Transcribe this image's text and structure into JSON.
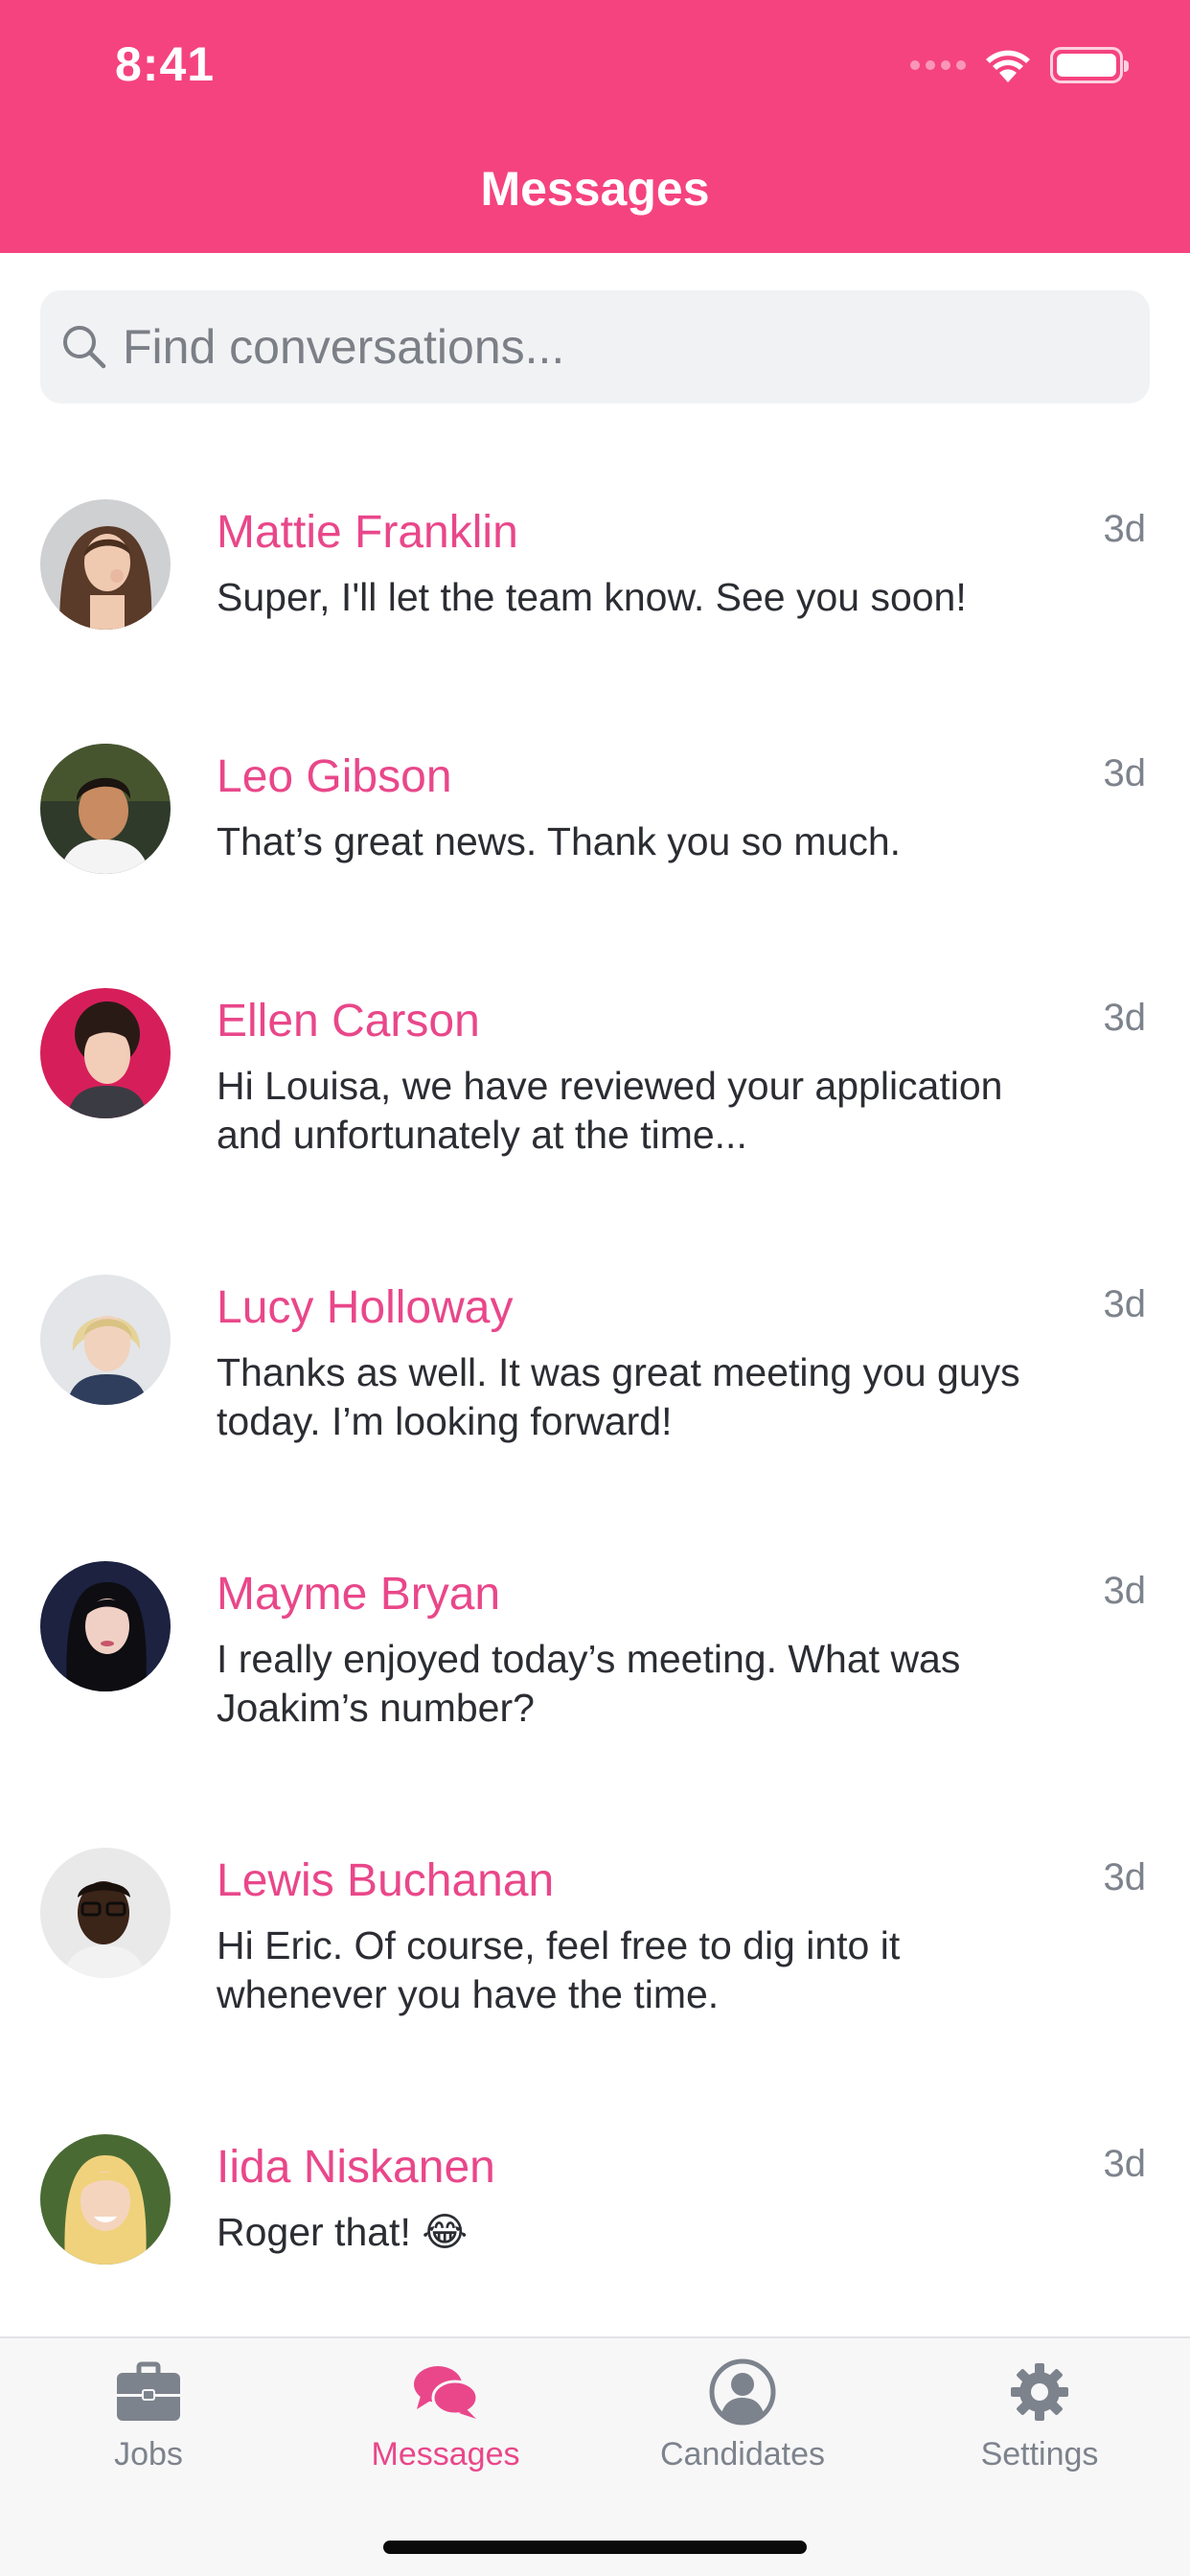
{
  "status_bar": {
    "time": "8:41"
  },
  "header": {
    "title": "Messages",
    "color": "#f5437f"
  },
  "search": {
    "placeholder": "Find conversations...",
    "value": ""
  },
  "conversations": [
    {
      "name": "Mattie Franklin",
      "preview": "Super, I'll let the team know. See you soon!",
      "time": "3d"
    },
    {
      "name": "Leo Gibson",
      "preview": "That’s great news. Thank you so much.",
      "time": "3d"
    },
    {
      "name": "Ellen Carson",
      "preview": "Hi Louisa, we have reviewed your application and unfortunately at the time...",
      "time": "3d"
    },
    {
      "name": "Lucy Holloway",
      "preview": "Thanks as well. It was great meeting you guys today. I’m looking forward!",
      "time": "3d"
    },
    {
      "name": "Mayme Bryan",
      "preview": "I really enjoyed today’s meeting. What was Joakim’s number?",
      "time": "3d"
    },
    {
      "name": "Lewis Buchanan",
      "preview": "Hi Eric. Of course, feel free to dig into it whenever you have the time.",
      "time": "3d"
    },
    {
      "name": "Iida Niskanen",
      "preview": "Roger that! 😂",
      "time": "3d"
    }
  ],
  "tabs": [
    {
      "label": "Jobs",
      "icon": "briefcase-icon",
      "active": false
    },
    {
      "label": "Messages",
      "icon": "chat-bubbles-icon",
      "active": true
    },
    {
      "label": "Candidates",
      "icon": "user-circle-icon",
      "active": false
    },
    {
      "label": "Settings",
      "icon": "gear-icon",
      "active": false
    }
  ],
  "colors": {
    "accent": "#e9478a",
    "header": "#f5437f",
    "muted": "#7d838c",
    "text": "#2b2d33"
  }
}
